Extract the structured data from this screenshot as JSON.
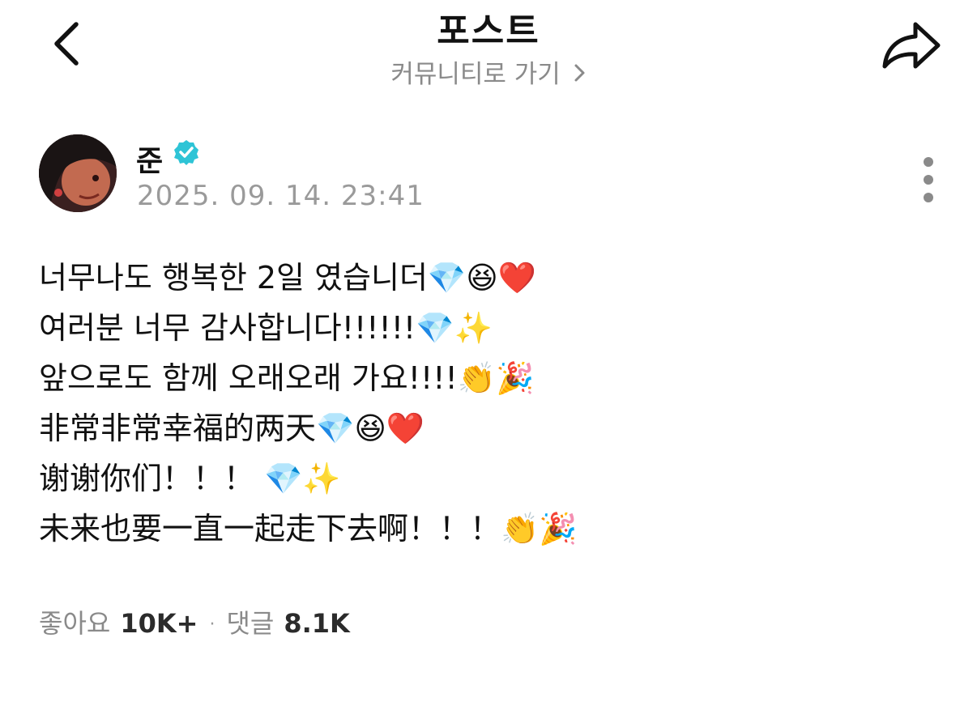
{
  "header": {
    "title": "포스트",
    "community_link": "커뮤니티로 가기",
    "back_icon": "chevron-left-icon",
    "share_icon": "share-arrow-icon"
  },
  "author": {
    "name": "준",
    "verified_icon": "verified-badge-icon",
    "verified_color": "#2ec4d6",
    "date": "2025. 09. 14. 23:41",
    "more_icon": "more-vertical-icon"
  },
  "post": {
    "lines": [
      "너무나도 행복한 2일 였습니더💎😆❤️",
      "여러분 너무 감사합니다!!!!!!💎✨",
      "앞으로도 함께 오래오래 가요!!!!👏🎉",
      "非常非常幸福的两天💎😆❤️",
      "谢谢你们！！！ 💎✨",
      "未来也要一直一起走下去啊！！！👏🎉"
    ]
  },
  "stats": {
    "likes_label": "좋아요",
    "likes_value": "10K+",
    "separator": "·",
    "comments_label": "댓글",
    "comments_value": "8.1K"
  }
}
